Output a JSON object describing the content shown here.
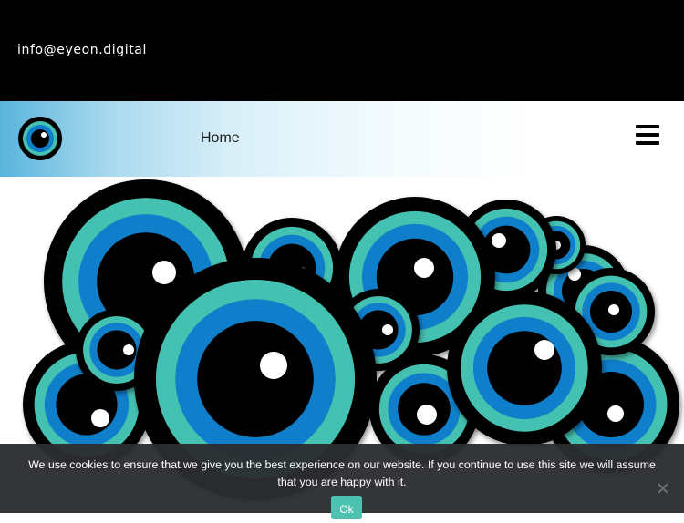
{
  "topbar": {
    "email": "info@eyeon.digital"
  },
  "nav": {
    "logo_icon": "eye-logo-icon",
    "home_label": "Home",
    "menu_icon": "hamburger-menu-icon"
  },
  "hero": {
    "image_icon": "eyes-illustration",
    "colors": {
      "ring_outer": "#000000",
      "ring_teal": "#45c1b1",
      "ring_blue": "#0f7fcb",
      "pupil": "#000000",
      "highlight": "#ffffff"
    }
  },
  "cookie": {
    "message": "We use cookies to ensure that we give you the best experience on our website. If you continue to use this site we will assume that you are happy with it.",
    "ok_label": "Ok",
    "close_icon": "close-icon",
    "accent": "#4ec2b0"
  }
}
